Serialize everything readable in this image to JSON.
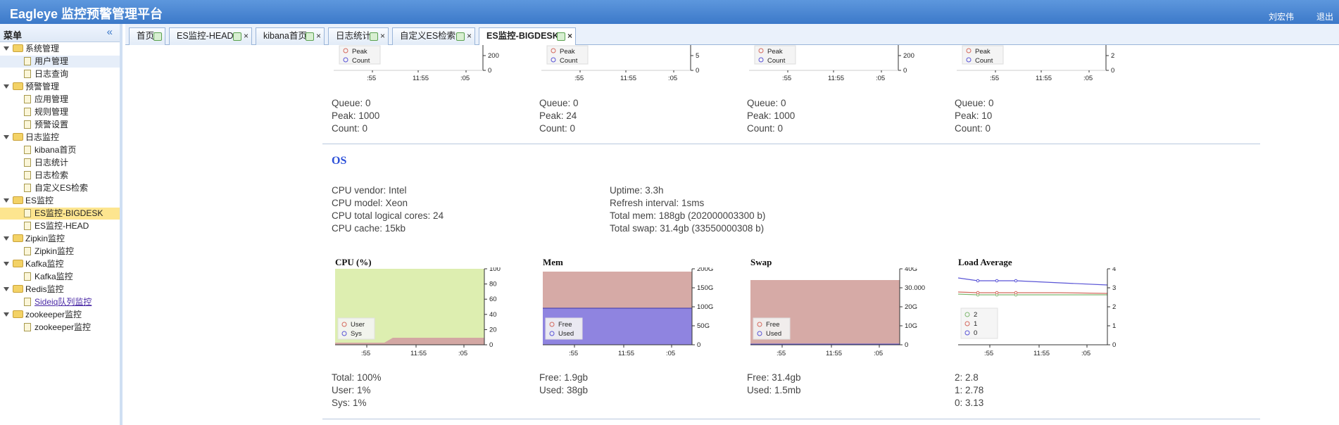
{
  "app": {
    "title": "Eagleye 监控预警管理平台",
    "user": "刘宏伟",
    "logout": "退出"
  },
  "sidebar": {
    "title": "菜单",
    "collapse_icon": "double-chevron-left-icon",
    "groups": [
      {
        "label": "系统管理",
        "items": [
          "用户管理",
          "日志查询"
        ]
      },
      {
        "label": "预警管理",
        "items": [
          "应用管理",
          "规则管理",
          "预警设置"
        ]
      },
      {
        "label": "日志监控",
        "items": [
          "kibana首页",
          "日志统计",
          "日志检索",
          "自定义ES检索"
        ]
      },
      {
        "label": "ES监控",
        "items": [
          "ES监控-BIGDESK",
          "ES监控-HEAD"
        ]
      },
      {
        "label": "Zipkin监控",
        "items": [
          "Zipkin监控"
        ]
      },
      {
        "label": "Kafka监控",
        "items": [
          "Kafka监控"
        ]
      },
      {
        "label": "Redis监控",
        "items": [
          "Sideiq队列监控"
        ]
      },
      {
        "label": "zookeeper监控",
        "items": [
          "zookeeper监控"
        ]
      }
    ]
  },
  "tabs": [
    "首页",
    "ES监控-HEAD",
    "kibana首页",
    "日志统计",
    "自定义ES检索",
    "ES监控-BIGDESK"
  ],
  "threadpools": [
    {
      "legend": [
        "Peak",
        "Count"
      ],
      "yticks": [
        "200",
        "0"
      ],
      "queue": "Queue: 0",
      "peak": "Peak: 1000",
      "count": "Count: 0"
    },
    {
      "legend": [
        "Peak",
        "Count"
      ],
      "yticks": [
        "5",
        "0"
      ],
      "queue": "Queue: 0",
      "peak": "Peak: 24",
      "count": "Count: 0"
    },
    {
      "legend": [
        "Peak",
        "Count"
      ],
      "yticks": [
        "200",
        "0"
      ],
      "queue": "Queue: 0",
      "peak": "Peak: 1000",
      "count": "Count: 0"
    },
    {
      "legend": [
        "Peak",
        "Count"
      ],
      "yticks": [
        "2",
        "0"
      ],
      "queue": "Queue: 0",
      "peak": "Peak: 10",
      "count": "Count: 0"
    }
  ],
  "xticks": [
    ":55",
    "11:55",
    ":05"
  ],
  "os": {
    "title": "OS",
    "left": [
      "CPU vendor: Intel",
      "CPU model: Xeon",
      "CPU total logical cores: 24",
      "CPU cache: 15kb"
    ],
    "right": [
      "Uptime: 3.3h",
      "Refresh interval: 1sms",
      "Total mem: 188gb (202000003300 b)",
      "Total swap: 31.4gb (33550000308 b)"
    ]
  },
  "charts": [
    {
      "title": "CPU (%)",
      "yticks": [
        "100",
        "80",
        "60",
        "40",
        "20",
        "0"
      ],
      "legend": [
        "User",
        "Sys"
      ],
      "colors": [
        "#ddeeb0",
        "#d3a7a3"
      ]
    },
    {
      "title": "Mem",
      "yticks": [
        "200G",
        "150G",
        "100G",
        "50G",
        "0"
      ],
      "legend": [
        "Free",
        "Used"
      ],
      "colors": [
        "#d6aaa6",
        "#8f84e0"
      ]
    },
    {
      "title": "Swap",
      "yticks": [
        "40G",
        "30.000",
        "20G",
        "10G",
        "0"
      ],
      "legend": [
        "Free",
        "Used"
      ],
      "colors": [
        "#d6aaa6",
        "#8f84e0"
      ]
    },
    {
      "title": "Load Average",
      "yticks": [
        "4",
        "3",
        "2",
        "1",
        "0"
      ],
      "legend": [
        "2",
        "1",
        "0"
      ],
      "colors": [
        "#7fb870",
        "#d46a5e",
        "#5a55d6"
      ]
    }
  ],
  "bottom_stats": {
    "cpu": [
      "Total: 100%",
      "User: 1%",
      "Sys: 1%"
    ],
    "mem": [
      "Free: 1.9gb",
      "Used: 38gb"
    ],
    "swap": [
      "Free: 31.4gb",
      "Used: 1.5mb"
    ],
    "load": [
      "2: 2.8",
      "1: 2.78",
      "0: 3.13"
    ]
  }
}
